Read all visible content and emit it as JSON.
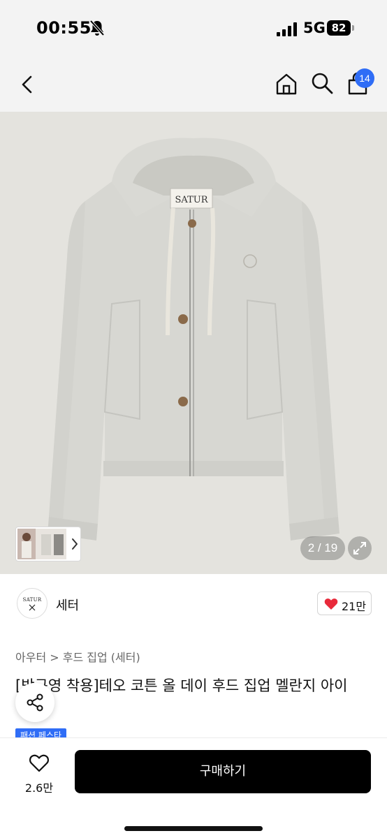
{
  "status_bar": {
    "time": "00:55",
    "network": "5G",
    "battery": "82",
    "icons": [
      "bell-slash-icon",
      "signal-icon",
      "battery-icon"
    ]
  },
  "nav": {
    "icons": [
      "back-icon",
      "home-icon",
      "search-icon",
      "bag-icon"
    ],
    "cart_badge": "14",
    "accent_color": "#2f6df6"
  },
  "gallery": {
    "counter": "2 / 19",
    "product_label": "SATUR",
    "thumbnail_icon": "chevron-right-icon",
    "expand_icon": "expand-icon"
  },
  "brand": {
    "logo_text": "SATUR",
    "name": "세터",
    "like_count": "21만",
    "like_icon": "heart-filled-icon",
    "like_color": "#e8293a"
  },
  "product": {
    "category": "아우터 > 후드 집업 (세터)",
    "title": "[박규영 착용]테오 코튼 올 데이 후드 집업 멜란지 아이",
    "promo_badge": "패션 페스타"
  },
  "bottom_bar": {
    "wishlist_count": "2.6만",
    "buy_label": "구매하기"
  }
}
